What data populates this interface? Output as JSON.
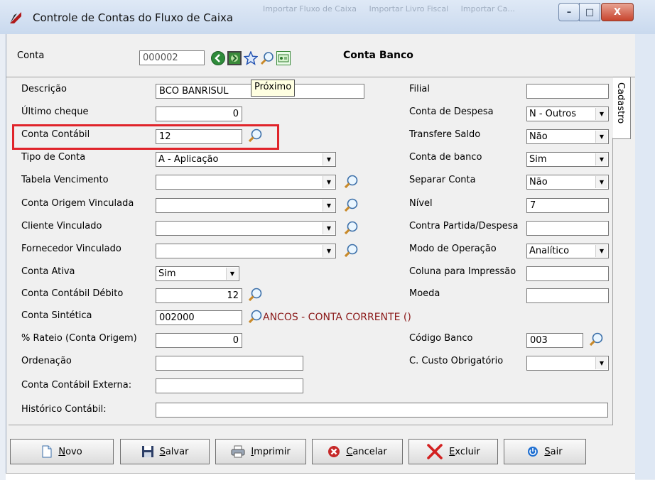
{
  "window": {
    "title": "Controle de Contas do Fluxo de Caixa",
    "background_tabs": [
      "Importar Fluxo de Caixa",
      "Importar Livro Fiscal",
      "Importar Ca..."
    ],
    "minimize_label": "–",
    "maximize_label": "□",
    "close_label": "X"
  },
  "header": {
    "conta_label": "Conta",
    "conta_value": "000002",
    "section_title": "Conta Banco",
    "tooltip": "Próximo"
  },
  "side_tab": {
    "label": "Cadastro"
  },
  "left_fields": {
    "descricao": {
      "label": "Descrição",
      "value": "BCO BANRISUL"
    },
    "ultimo_cheque": {
      "label": "Último cheque",
      "value": "0"
    },
    "conta_contabil": {
      "label": "Conta Contábil",
      "value": "12"
    },
    "tipo_conta": {
      "label": "Tipo de Conta",
      "value": "A - Aplicação"
    },
    "tabela_vencimento": {
      "label": "Tabela Vencimento",
      "value": ""
    },
    "conta_origem_vinculada": {
      "label": "Conta Origem Vinculada",
      "value": ""
    },
    "cliente_vinculado": {
      "label": "Cliente Vinculado",
      "value": ""
    },
    "fornecedor_vinculado": {
      "label": "Fornecedor Vinculado",
      "value": ""
    },
    "conta_ativa": {
      "label": "Conta Ativa",
      "value": "Sim"
    },
    "conta_contabil_debito": {
      "label": "Conta Contábil Débito",
      "value": "12"
    },
    "conta_sintetica": {
      "label": "Conta Sintética",
      "value": "002000",
      "description": "ANCOS - CONTA CORRENTE ()"
    },
    "rateio": {
      "label": "% Rateio (Conta Origem)",
      "value": "0"
    },
    "ordenacao": {
      "label": "Ordenação",
      "value": ""
    },
    "conta_contabil_externa": {
      "label": "Conta Contábil Externa:",
      "value": ""
    },
    "historico_contabil": {
      "label": "Histórico Contábil:",
      "value": ""
    }
  },
  "right_fields": {
    "filial": {
      "label": "Filial",
      "value": ""
    },
    "conta_despesa": {
      "label": "Conta de Despesa",
      "value": "N - Outros"
    },
    "transfere_saldo": {
      "label": "Transfere Saldo",
      "value": "Não"
    },
    "conta_banco": {
      "label": "Conta de banco",
      "value": "Sim"
    },
    "separar_conta": {
      "label": "Separar Conta",
      "value": "Não"
    },
    "nivel": {
      "label": "Nível",
      "value": "7"
    },
    "contra_partida": {
      "label": "Contra Partida/Despesa",
      "value": ""
    },
    "modo_operacao": {
      "label": "Modo de Operação",
      "value": "Analítico"
    },
    "coluna_impressao": {
      "label": "Coluna para Impressão",
      "value": ""
    },
    "moeda": {
      "label": "Moeda",
      "value": ""
    },
    "codigo_banco": {
      "label": "Código Banco",
      "value": "003"
    },
    "c_custo_obrigatorio": {
      "label": "C. Custo Obrigatório",
      "value": ""
    }
  },
  "buttons": {
    "novo": {
      "underline": "N",
      "rest": "ovo"
    },
    "salvar": {
      "underline": "S",
      "rest": "alvar"
    },
    "imprimir": {
      "underline": "I",
      "rest": "mprimir"
    },
    "cancelar": {
      "underline": "C",
      "rest": "ancelar"
    },
    "excluir": {
      "underline": "E",
      "rest": "xcluir"
    },
    "sair": {
      "underline": "S",
      "rest": "air"
    }
  },
  "colors": {
    "highlight": "#e0242a",
    "description_text": "#8b1a1a"
  }
}
